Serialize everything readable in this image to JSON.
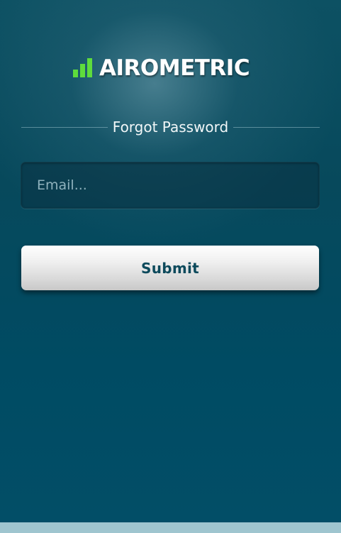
{
  "logo": {
    "icon": "signal-bars-icon",
    "text": "AIROMETRIC",
    "bar_color": "#5edc3c"
  },
  "form": {
    "heading": "Forgot Password",
    "email_placeholder": "Email...",
    "email_value": "",
    "submit_label": "Submit"
  },
  "colors": {
    "background": "#004b63",
    "button_text": "#0d4a5c",
    "bottom_strip": "#9fc5cf"
  }
}
